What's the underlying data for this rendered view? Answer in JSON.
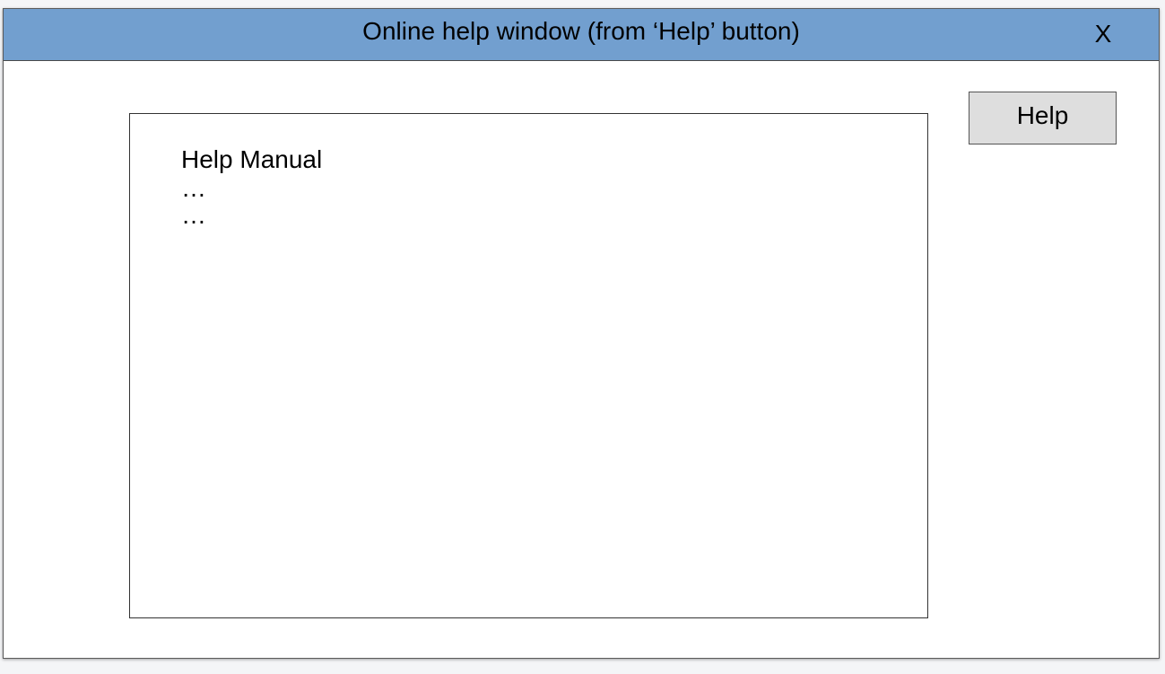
{
  "window": {
    "title": "Online help window (from ‘Help’ button)",
    "close_label": "X"
  },
  "toolbar": {
    "help_label": "Help"
  },
  "content": {
    "heading": "Help Manual",
    "lines": [
      "…",
      "…"
    ]
  },
  "colors": {
    "titlebar": "#729fcf",
    "button_bg": "#dedede",
    "window_bg": "#ffffff"
  }
}
